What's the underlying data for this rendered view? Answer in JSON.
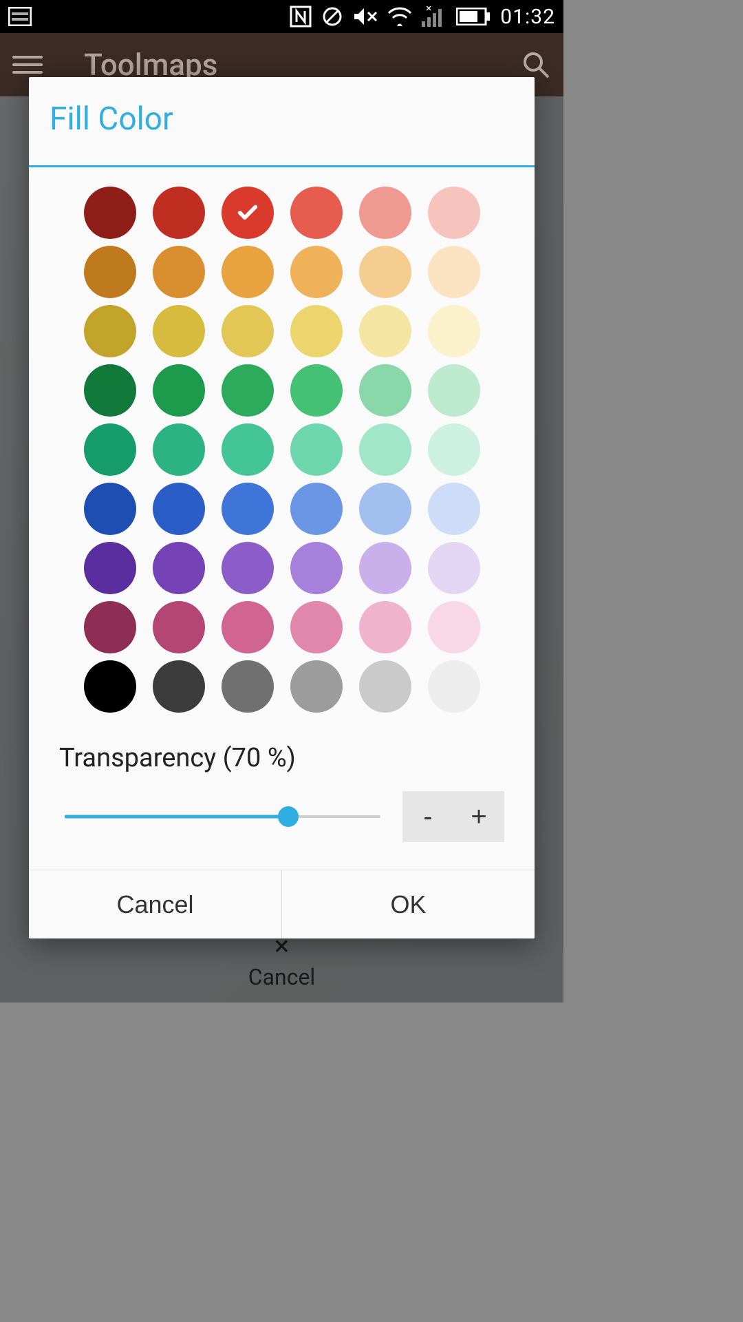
{
  "statusbar": {
    "time": "01:32",
    "icons": [
      "nfc",
      "blocked",
      "volume-muted",
      "wifi",
      "cell-no-signal",
      "battery"
    ]
  },
  "appbar": {
    "title": "Toolmaps"
  },
  "background": {
    "cancel_icon": "×",
    "cancel_label": "Cancel"
  },
  "dialog": {
    "title": "Fill Color",
    "selected_index": 2,
    "swatches": [
      "#8f1d18",
      "#c02e21",
      "#d93a2b",
      "#e65c4f",
      "#ef9a90",
      "#f6c3bd",
      "#c07a1e",
      "#d98f2f",
      "#e8a23f",
      "#f0b259",
      "#f6cd91",
      "#fbe3c2",
      "#c2a32c",
      "#d7bb3f",
      "#e2c756",
      "#ecd56d",
      "#f4e6a2",
      "#f9f2cd",
      "#117a3a",
      "#1e9a4d",
      "#2cab5c",
      "#45c175",
      "#8ad8aa",
      "#bde9cf",
      "#169c6b",
      "#2db382",
      "#44c595",
      "#6dd6ac",
      "#a2e6c9",
      "#cdf1e1",
      "#1f4eb3",
      "#2a5ec6",
      "#3f74d9",
      "#6a96e5",
      "#a3bff0",
      "#cddcf7",
      "#5a2e9e",
      "#7442b5",
      "#8c5cc9",
      "#a680da",
      "#c9b0ea",
      "#e3d6f4",
      "#8e2e55",
      "#b34673",
      "#cf6590",
      "#e187ab",
      "#efb3cb",
      "#f7d8e4",
      "#000000",
      "#3c3c3c",
      "#707070",
      "#9c9c9c",
      "#cacaca",
      "#ededed"
    ],
    "transparency": {
      "label_prefix": "Transparency",
      "value": 70,
      "unit": "%",
      "minus": "-",
      "plus": "+"
    },
    "actions": {
      "cancel": "Cancel",
      "ok": "OK"
    }
  }
}
